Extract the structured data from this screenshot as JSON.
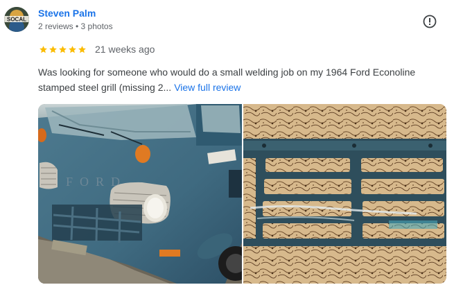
{
  "reviewer": {
    "name": "Steven Palm",
    "meta": "2 reviews • 3 photos",
    "avatar_text": "SOCAL"
  },
  "review": {
    "rating": 5,
    "rating_max": 5,
    "date": "21 weeks ago",
    "text": "Was looking for someone who would do a small welding job on my 1964 Ford Econoline stamped steel grill (missing 2...",
    "more_label": "View full review"
  },
  "photos": [
    {
      "subject": "blue 1964 Ford Econoline van front",
      "lettering": "FORD"
    },
    {
      "subject": "rusty stamped steel grille close-up"
    }
  ],
  "colors": {
    "name_link": "#1a73e8",
    "star": "#fbbc04",
    "meta_text": "#5f6368",
    "body_text": "#3c4043"
  },
  "icons": {
    "report": "exclamation-circle-icon",
    "star": "star-icon"
  }
}
